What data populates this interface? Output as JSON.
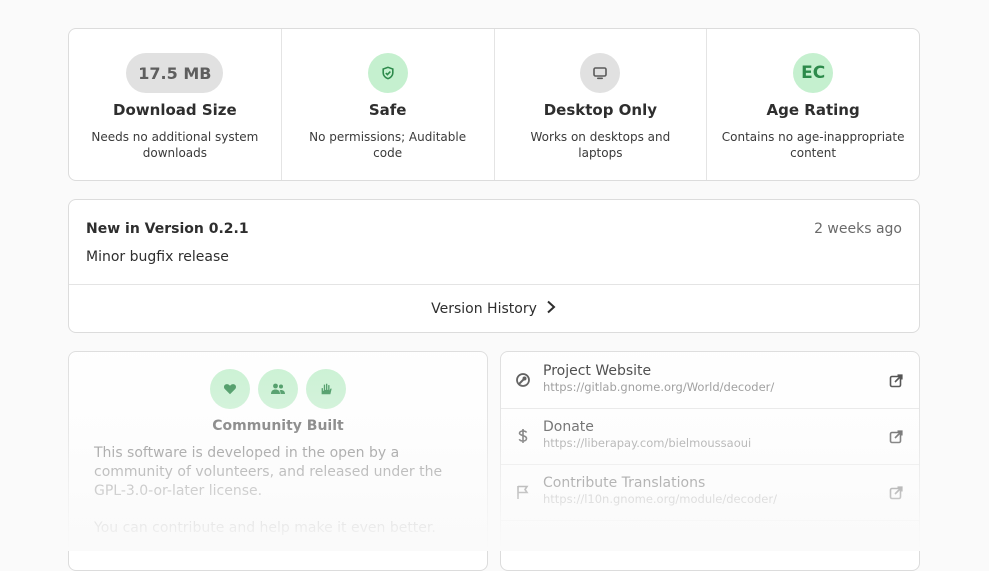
{
  "context_tiles": [
    {
      "pill": "17.5 MB",
      "title": "Download Size",
      "description": "Needs no additional system downloads"
    },
    {
      "pill_icon": "shield-check-icon",
      "title": "Safe",
      "description": "No permissions; Auditable code"
    },
    {
      "pill_icon": "desktop-icon",
      "title": "Desktop Only",
      "description": "Works on desktops and laptops"
    },
    {
      "pill": "EC",
      "title": "Age Rating",
      "description": "Contains no age-inappropriate content"
    }
  ],
  "version": {
    "heading": "New in Version 0.2.1",
    "time": "2 weeks ago",
    "notes": "Minor bugfix release",
    "history_label": "Version History"
  },
  "community": {
    "badges": [
      "heart-icon",
      "people-icon",
      "hand-raised-icon"
    ],
    "title": "Community Built",
    "text": "This software is developed in the open by a community of volunteers, and released under the GPL-3.0-or-later license.",
    "text2": "You can contribute and help make it even better."
  },
  "links": [
    {
      "icon": "gitlab-icon",
      "title": "Project Website",
      "url": "https://gitlab.gnome.org/World/decoder/"
    },
    {
      "icon": "dollar-icon",
      "title": "Donate",
      "url": "https://liberapay.com/bielmoussaoui"
    },
    {
      "icon": "flag-icon",
      "title": "Contribute Translations",
      "url": "https://l10n.gnome.org/module/decoder/"
    }
  ],
  "colors": {
    "accent_green": "#2d8a4b",
    "badge_green_bg": "#c5f0cf",
    "neutral_pill_bg": "#e1e1e1"
  }
}
